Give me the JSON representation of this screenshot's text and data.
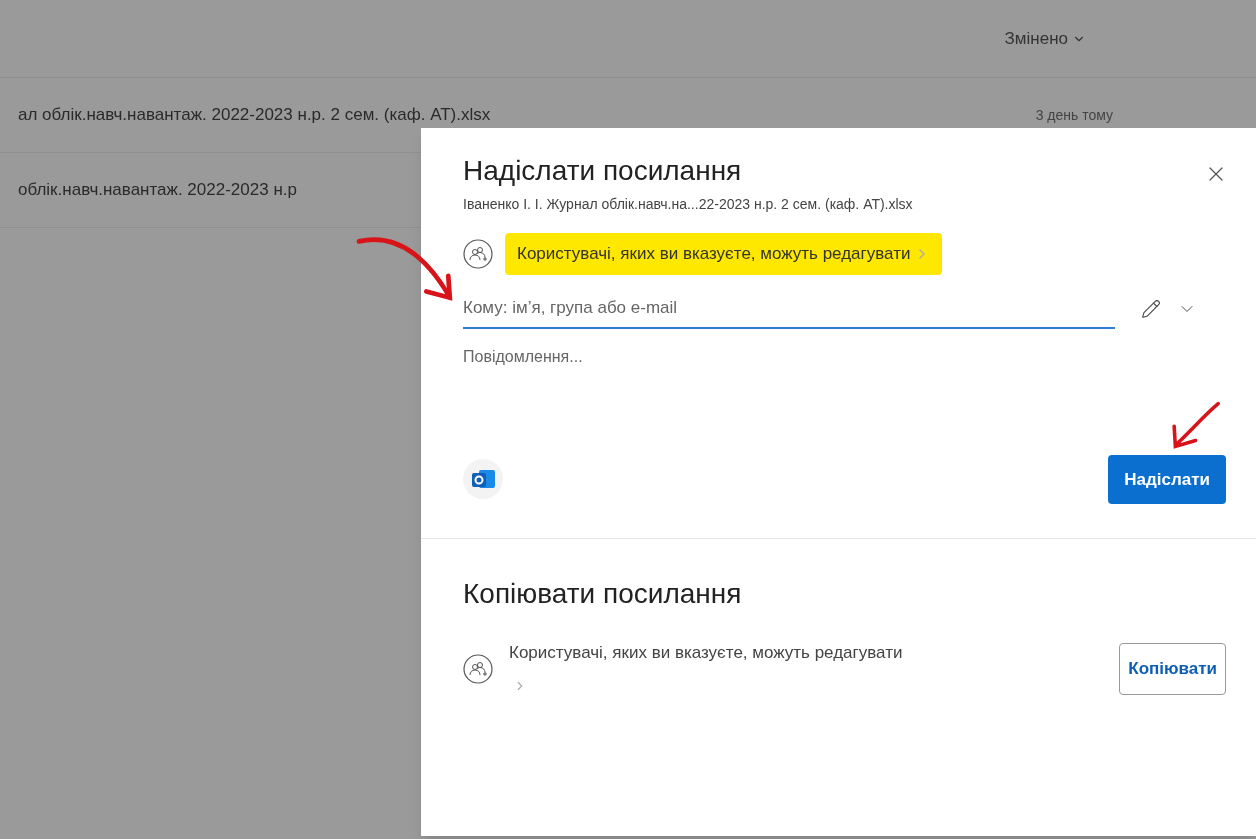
{
  "file_list": {
    "modified_column": "Змінено",
    "rows": [
      {
        "name": "ал облік.навч.навантаж. 2022-2023 н.р. 2 сем. (каф. АТ).xlsx",
        "modified": "3 день тому"
      },
      {
        "name": "облік.навч.навантаж. 2022-2023 н.р"
      }
    ]
  },
  "send_link": {
    "title": "Надіслати посилання",
    "file_name": "Іваненко І. І. Журнал облік.навч.на...22-2023 н.р. 2 сем. (каф. АТ).xlsx",
    "permission": "Користувачі, яких ви вказуєте, можуть редагувати",
    "permission_highlighted": true,
    "to_placeholder": "Кому: ім’я, група або e-mail",
    "message_placeholder": "Повідомлення...",
    "send_button": "Надіслати"
  },
  "copy_link": {
    "title": "Копіювати посилання",
    "permission": "Користувачі, яких ви вказуєте, можуть редагувати",
    "copy_button": "Копіювати"
  }
}
